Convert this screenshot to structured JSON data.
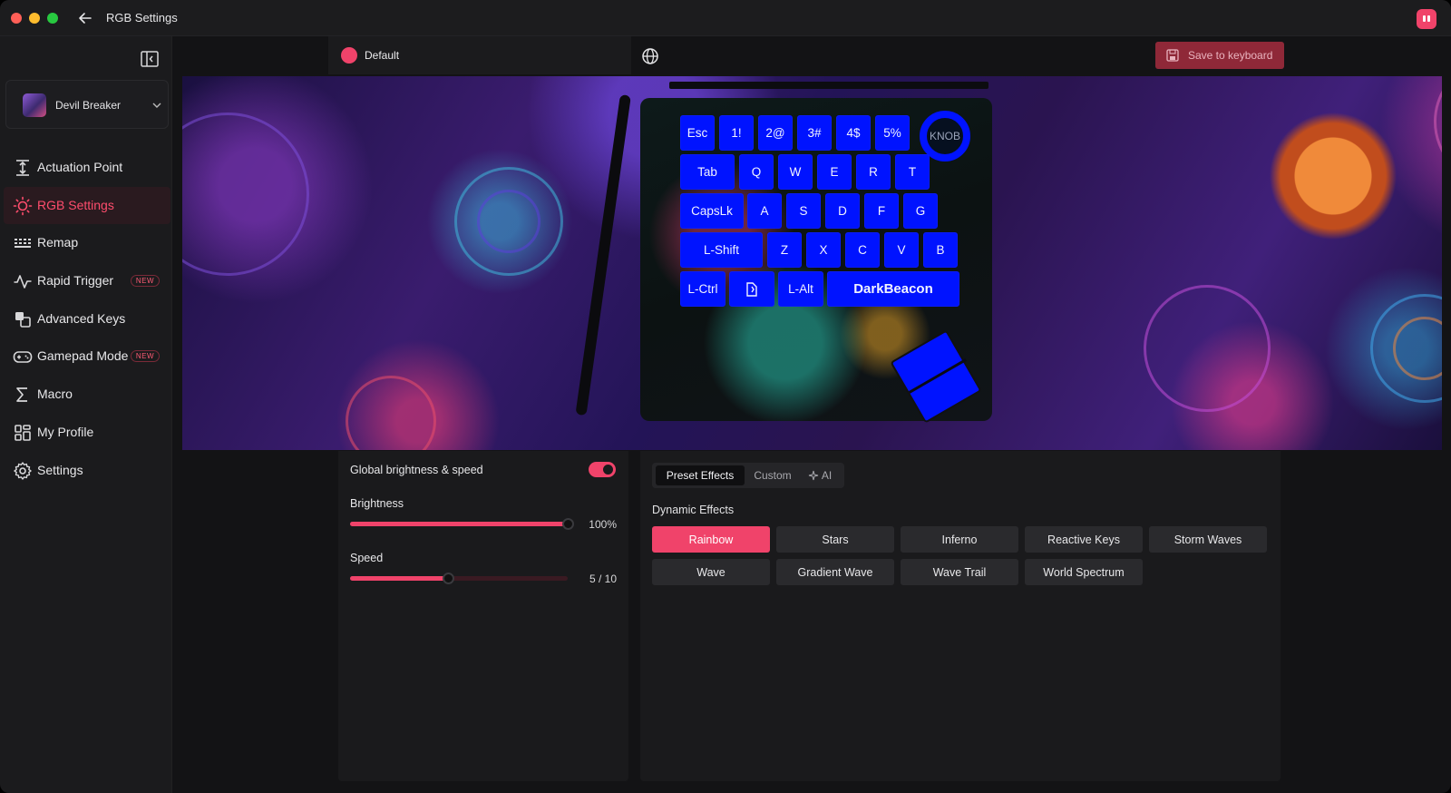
{
  "window": {
    "title": "RGB Settings"
  },
  "sidebar": {
    "device": {
      "name": "Devil Breaker"
    },
    "items": [
      {
        "label": "Actuation Point",
        "icon": "actuation-icon",
        "new": false,
        "active": false
      },
      {
        "label": "RGB Settings",
        "icon": "sun-icon",
        "new": false,
        "active": true
      },
      {
        "label": "Remap",
        "icon": "keyboard-grid-icon",
        "new": false,
        "active": false
      },
      {
        "label": "Rapid Trigger",
        "icon": "pulse-icon",
        "new": true,
        "active": false
      },
      {
        "label": "Advanced Keys",
        "icon": "layers-icon",
        "new": false,
        "active": false
      },
      {
        "label": "Gamepad Mode",
        "icon": "gamepad-icon",
        "new": true,
        "active": false
      },
      {
        "label": "Macro",
        "icon": "sigma-icon",
        "new": false,
        "active": false
      },
      {
        "label": "My Profile",
        "icon": "grid-profile-icon",
        "new": false,
        "active": false
      },
      {
        "label": "Settings",
        "icon": "gear-icon",
        "new": false,
        "active": false
      }
    ],
    "new_badge": "NEW"
  },
  "header": {
    "profile_name": "Default",
    "profile_color": "#f0436a",
    "save_label": "Save to keyboard"
  },
  "keyboard": {
    "knob_label": "KNOB",
    "rows": [
      [
        "Esc",
        "1!",
        "2@",
        "3#",
        "4$",
        "5%"
      ],
      [
        "Tab",
        "Q",
        "W",
        "E",
        "R",
        "T"
      ],
      [
        "CapsLk",
        "A",
        "S",
        "D",
        "F",
        "G"
      ],
      [
        "L-Shift",
        "Z",
        "X",
        "C",
        "V",
        "B"
      ],
      [
        "L-Ctrl",
        "",
        "L-Alt",
        "DarkBeacon"
      ]
    ],
    "key_color": "#0013ff"
  },
  "lighting": {
    "global_label": "Global brightness & speed",
    "global_enabled": true,
    "brightness": {
      "label": "Brightness",
      "value_text": "100%",
      "fraction": 1.0
    },
    "speed": {
      "label": "Speed",
      "value_text": "5 / 10",
      "fraction": 0.45
    }
  },
  "effects": {
    "tabs": [
      "Preset Effects",
      "Custom",
      "AI"
    ],
    "active_tab": "Preset Effects",
    "section_title": "Dynamic Effects",
    "items": [
      "Rainbow",
      "Stars",
      "Inferno",
      "Reactive Keys",
      "Storm Waves",
      "Wave",
      "Gradient Wave",
      "Wave Trail",
      "World Spectrum"
    ],
    "selected": "Rainbow",
    "accent": "#f0436a"
  }
}
